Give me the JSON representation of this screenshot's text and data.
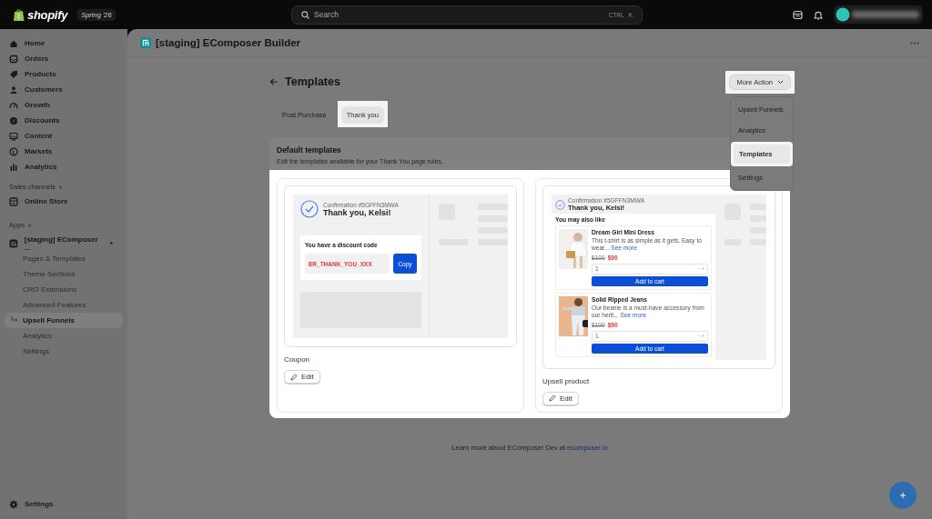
{
  "top_bar": {
    "brand": "shopify",
    "edition": "Spring '26",
    "search": {
      "placeholder": "Search",
      "shortcut": "CTRL",
      "shortcut_key": "K"
    }
  },
  "sidebar": {
    "items": [
      {
        "label": "Home",
        "selected": false
      },
      {
        "label": "Orders",
        "selected": false
      },
      {
        "label": "Products",
        "selected": false
      },
      {
        "label": "Customers",
        "selected": false
      },
      {
        "label": "Growth",
        "selected": false
      },
      {
        "label": "Discounts",
        "selected": false
      },
      {
        "label": "Content",
        "selected": false
      },
      {
        "label": "Markets",
        "selected": false
      },
      {
        "label": "Analytics",
        "selected": false
      }
    ],
    "sales_channels": {
      "heading": "Sales channels",
      "items": [
        {
          "label": "Online Store",
          "selected": false
        }
      ]
    },
    "apps": {
      "heading": "Apps",
      "app": {
        "name": "[staging] EComposer ...",
        "children": [
          {
            "label": "Pages & Templates",
            "selected": false
          },
          {
            "label": "Theme Sections",
            "selected": false
          },
          {
            "label": "CRO Extensions",
            "selected": false
          },
          {
            "label": "Advanced Features",
            "selected": false
          },
          {
            "label": "Upsell Funnels",
            "selected": true
          },
          {
            "label": "Analytics",
            "selected": false
          },
          {
            "label": "Settings",
            "selected": false
          }
        ]
      }
    },
    "footer_item": {
      "label": "Settings"
    }
  },
  "app_header": {
    "title": "[staging] EComposer Builder"
  },
  "page": {
    "title": "Templates",
    "more_action": {
      "label": "More Action",
      "highlighted": true,
      "expanded": true,
      "menu": [
        {
          "label": "Upsell Funnels",
          "selected": false,
          "highlighted": false
        },
        {
          "label": "Analytics",
          "selected": false,
          "highlighted": false
        },
        {
          "label": "Templates",
          "selected": true,
          "highlighted": true
        },
        {
          "label": "Settings",
          "selected": false,
          "highlighted": false
        }
      ]
    },
    "tabs": [
      {
        "label": "Post Purchase",
        "selected": false,
        "highlighted": false
      },
      {
        "label": "Thank you",
        "selected": true,
        "highlighted": true
      }
    ],
    "card": {
      "title": "Default templates",
      "subtitle": "Edit the templates available for your Thank You page rules.",
      "highlighted": true,
      "templates": [
        {
          "kind": "coupon",
          "name": "Coupon",
          "edit": "Edit",
          "preview": {
            "confirmation": "Confirmation #5GFFN3MWA",
            "greeting": "Thank you, Kelsi!",
            "discount_label": "You have a discount code",
            "code": "ER_THANK_YOU_XXX",
            "copy": "Copy"
          }
        },
        {
          "kind": "upsell",
          "name": "Upsell product",
          "edit": "Edit",
          "preview": {
            "confirmation": "Confirmation #5GFFN3MWA",
            "greeting": "Thank you, Kelsi!",
            "heading": "You may also like",
            "products": [
              {
                "name": "Dream Girl Mini Dress",
                "description": "This t-shirt is as simple as it gets. Easy to wear...",
                "more": "See more",
                "old_price": "$100",
                "price": "$90",
                "quantity": "1",
                "button": "Add to cart"
              },
              {
                "name": "Solid Ripped Jeans",
                "description": "Our beanie is a must-have accessory from our herit...",
                "more": "See more",
                "old_price": "$100",
                "price": "$90",
                "quantity": "1",
                "button": "Add to cart"
              }
            ]
          }
        }
      ]
    }
  },
  "footer": {
    "text": "Learn more about EComposer Dev at",
    "link": "ecomposer.io"
  }
}
